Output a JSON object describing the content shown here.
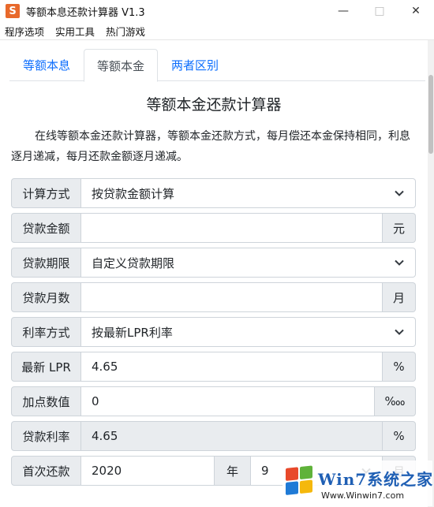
{
  "window": {
    "app_icon_letter": "S",
    "title": "等额本息还款计算器   V1.3",
    "minimize": "—",
    "maximize": "□",
    "close": "✕"
  },
  "menu": [
    "程序选项",
    "实用工具",
    "热门游戏"
  ],
  "tabs": [
    {
      "label": "等额本息",
      "active": false
    },
    {
      "label": "等额本金",
      "active": true
    },
    {
      "label": "两者区别",
      "active": false
    }
  ],
  "heading": "等额本金还款计算器",
  "description": "在线等额本金还款计算器，等额本金还款方式，每月偿还本金保持相同，利息逐月递减，每月还款金额逐月递减。",
  "form": {
    "calc_method": {
      "label": "计算方式",
      "value": "按贷款金额计算"
    },
    "loan_amount": {
      "label": "贷款金额",
      "value": "",
      "unit": "元"
    },
    "loan_term": {
      "label": "贷款期限",
      "value": "自定义贷款期限"
    },
    "loan_months": {
      "label": "贷款月数",
      "value": "",
      "unit": "月"
    },
    "rate_method": {
      "label": "利率方式",
      "value": "按最新LPR利率"
    },
    "latest_lpr": {
      "label": "最新 LPR",
      "value": "4.65",
      "unit": "%"
    },
    "basis_points": {
      "label": "加点数值",
      "value": "0",
      "unit": "‱"
    },
    "loan_rate": {
      "label": "贷款利率",
      "value": "4.65",
      "unit": "%"
    },
    "first_payment": {
      "label": "首次还款",
      "year": "2020",
      "year_unit": "年",
      "month": "9",
      "month_unit": "月"
    }
  },
  "watermark": {
    "text": "Win7系统之家",
    "url": "Www.Winwin7.com"
  }
}
